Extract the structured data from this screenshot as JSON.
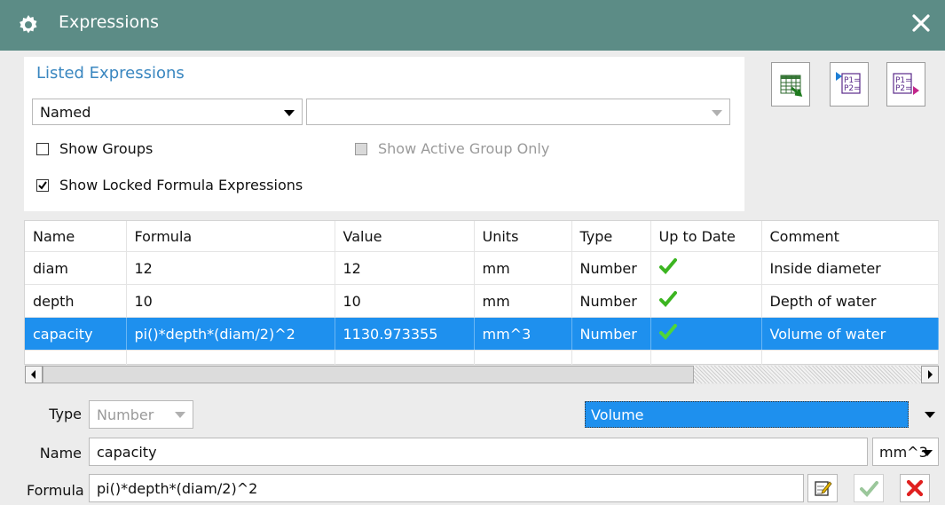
{
  "window": {
    "title": "Expressions"
  },
  "listed": {
    "heading": "Listed Expressions",
    "filter_value": "Named",
    "filter2_value": "",
    "show_groups": {
      "label": "Show Groups",
      "checked": false
    },
    "show_active_group_only": {
      "label": "Show Active Group Only",
      "checked": false,
      "enabled": false
    },
    "show_locked": {
      "label": "Show Locked Formula Expressions",
      "checked": true
    }
  },
  "toolbar": {
    "export_spreadsheet_icon": "spreadsheet-export-icon",
    "import_icon": "import-expressions-icon",
    "export_icon": "export-expressions-icon",
    "import_text": [
      "P1=",
      "P2="
    ],
    "export_text": [
      "P1=",
      "P2="
    ]
  },
  "table": {
    "columns": [
      "Name",
      "Formula",
      "Value",
      "Units",
      "Type",
      "Up to Date",
      "Comment"
    ],
    "rows": [
      {
        "name": "diam",
        "formula": "12",
        "value": "12",
        "units": "mm",
        "type": "Number",
        "up_to_date": true,
        "comment": "Inside diameter"
      },
      {
        "name": "depth",
        "formula": "10",
        "value": "10",
        "units": "mm",
        "type": "Number",
        "up_to_date": true,
        "comment": "Depth of water"
      },
      {
        "name": "capacity",
        "formula": "pi()*depth*(diam/2)^2",
        "value": "1130.973355",
        "units": "mm^3",
        "type": "Number",
        "up_to_date": true,
        "comment": "Volume of water",
        "selected": true
      }
    ]
  },
  "editor": {
    "type_label": "Type",
    "type_value": "Number",
    "dimension_value": "Volume",
    "name_label": "Name",
    "name_value": "capacity",
    "units_value": "mm^3",
    "formula_label": "Formula",
    "formula_value": "pi()*depth*(diam/2)^2"
  },
  "colors": {
    "titlebar": "#5c8c86",
    "accent": "#3a87c0",
    "selection": "#1e90ee",
    "check_green": "#3cb521",
    "cancel_red": "#e0201f"
  }
}
